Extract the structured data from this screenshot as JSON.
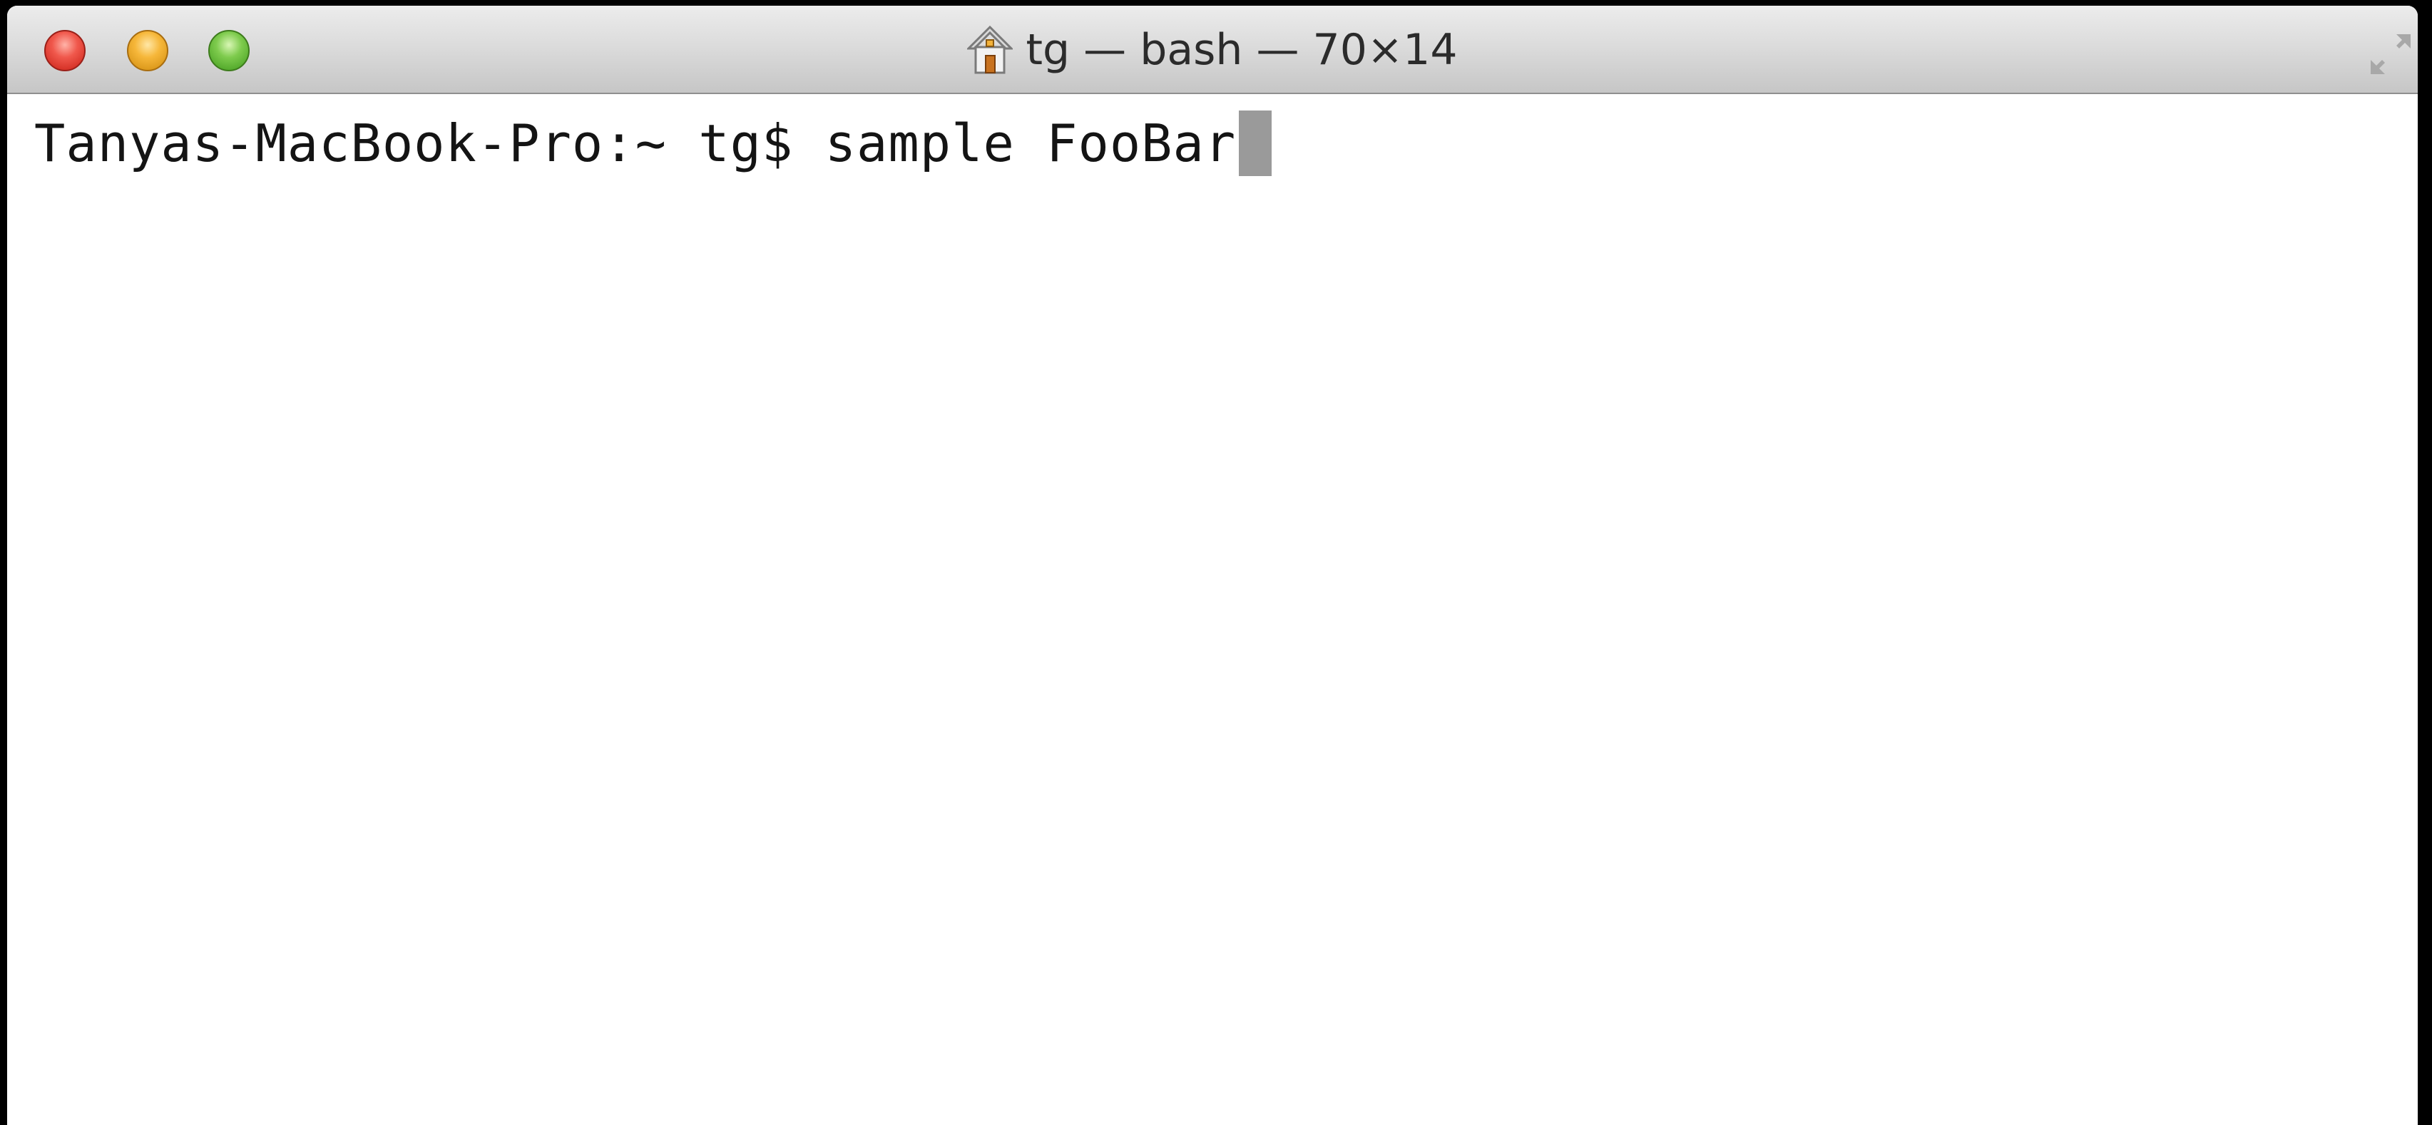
{
  "window": {
    "title": "tg — bash — 70×14",
    "controls": {
      "close_color": "#f0584c",
      "minimize_color": "#f6b73a",
      "zoom_color": "#7ecb4d"
    },
    "title_icon": "home-icon",
    "fullscreen_icon": "fullscreen-icon"
  },
  "terminal": {
    "prompt": "Tanyas-MacBook-Pro:~ tg$ ",
    "command": "sample FooBar",
    "background": "#ffffff",
    "text_color": "#141414",
    "cursor_color": "#9a9a9a"
  }
}
